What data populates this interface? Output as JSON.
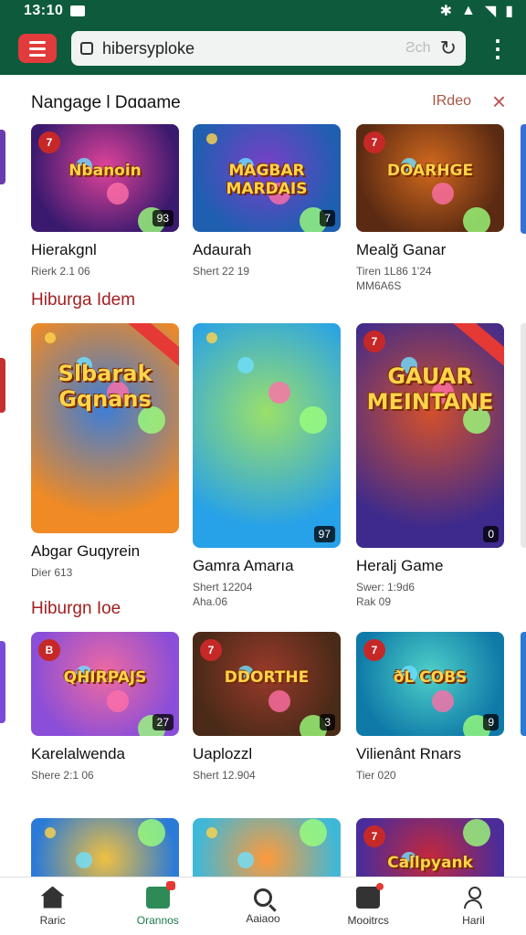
{
  "status": {
    "time": "13:10"
  },
  "appbar": {
    "url": "hibersyploke",
    "hint": "Ƨch"
  },
  "header": {
    "title": "Nangage l Dɑɑame",
    "action": "IRdeo"
  },
  "sections": [
    {
      "title": ""
    },
    {
      "title": "Hiburga Idem"
    },
    {
      "title": "Hiburgn Ioe"
    }
  ],
  "rows": [
    [
      {
        "name": "Hierakgnl",
        "meta1": "Rierk 2.1 06",
        "meta2": "",
        "badge": "7",
        "count": "93",
        "logo": "Nbanoin",
        "colors": [
          "#3a1a6e",
          "#e0439a"
        ]
      },
      {
        "name": "Adaurah",
        "meta1": "Shert 22 19",
        "meta2": "",
        "badge": "",
        "count": "7",
        "logo": "MAGBAR MARDAIS",
        "colors": [
          "#1e5fb0",
          "#7a3fc8"
        ]
      },
      {
        "name": "Mealğ Ganar",
        "meta1": "Tiren 1L86 1'24",
        "meta2": "MM6A6S",
        "badge": "7",
        "count": "",
        "logo": "DOARHGE",
        "colors": [
          "#5a2a12",
          "#d2691e"
        ]
      }
    ],
    [
      {
        "name": "Abgar Guqyrein",
        "meta1": "Dier 613",
        "meta2": "",
        "badge": "",
        "count": "",
        "logo": "Slbarak Gqnans",
        "colors": [
          "#f08a24",
          "#3b7dd8"
        ]
      },
      {
        "name": "Gamra Amarıa",
        "meta1": "Shert 12204",
        "meta2": "Aha.06",
        "badge": "",
        "count": "97",
        "logo": "",
        "colors": [
          "#27a1e8",
          "#9be06a"
        ]
      },
      {
        "name": "Heralj Game",
        "meta1": "Swer: 1:9d6",
        "meta2": "Rak 09",
        "badge": "7",
        "count": "0",
        "logo": "GAUAR MEINTANE",
        "colors": [
          "#3d2a8c",
          "#d2502c"
        ]
      }
    ],
    [
      {
        "name": "Karelalwenda",
        "meta1": "Shere 2:1 06",
        "meta2": "",
        "badge": "B",
        "count": "27",
        "logo": "QHIRPAJS",
        "colors": [
          "#8a4ed8",
          "#f06aa0"
        ]
      },
      {
        "name": "Uaplozzl",
        "meta1": "Shert 12.904",
        "meta2": "",
        "badge": "7",
        "count": "3",
        "logo": "DDORTHE",
        "colors": [
          "#4a2a18",
          "#9a3a2a"
        ]
      },
      {
        "name": "Vilienânt Rnars",
        "meta1": "Tier 020",
        "meta2": "",
        "badge": "7",
        "count": "9",
        "logo": "ðL COBS",
        "colors": [
          "#0f7aa8",
          "#4ed0c8"
        ]
      }
    ],
    [
      {
        "name": "",
        "meta1": "",
        "meta2": "",
        "badge": "",
        "count": "",
        "logo": "",
        "colors": [
          "#2a7ad8",
          "#f0c040"
        ]
      },
      {
        "name": "",
        "meta1": "",
        "meta2": "",
        "badge": "",
        "count": "",
        "logo": "",
        "colors": [
          "#3fb8d8",
          "#ff9a3a"
        ]
      },
      {
        "name": "",
        "meta1": "",
        "meta2": "",
        "badge": "7",
        "count": "",
        "logo": "Callpyank",
        "colors": [
          "#4a2c9a",
          "#c6283a"
        ]
      }
    ]
  ],
  "nav": [
    {
      "label": "Raric"
    },
    {
      "label": "Orannos"
    },
    {
      "label": "Aaiaoo"
    },
    {
      "label": "Mooitrcs"
    },
    {
      "label": "Haril"
    }
  ]
}
